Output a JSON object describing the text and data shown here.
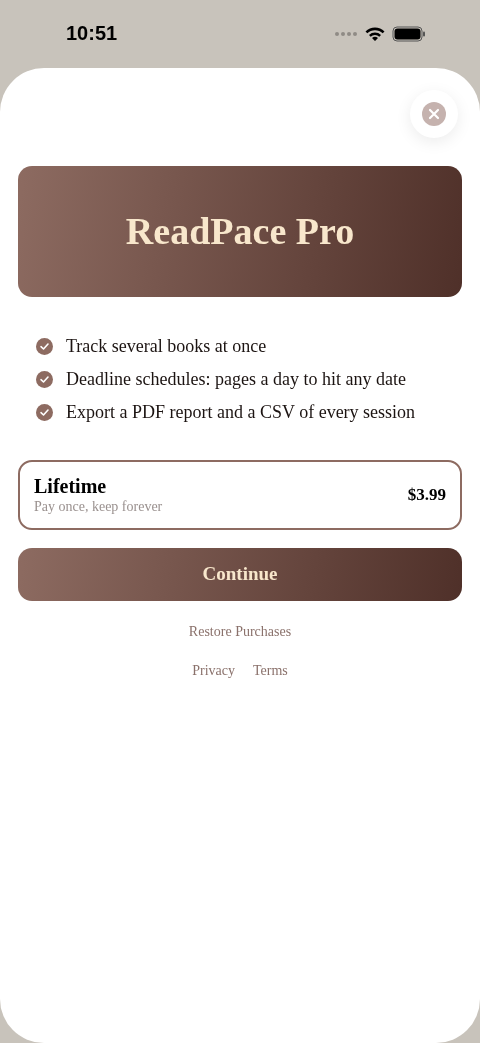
{
  "status_bar": {
    "time": "10:51"
  },
  "hero": {
    "title": "ReadPace Pro"
  },
  "features": [
    {
      "text": "Track several books at once",
      "checked": true
    },
    {
      "text": "Deadline schedules: pages a day to hit any date",
      "checked": true
    },
    {
      "text": "Export a PDF report and a CSV of every session",
      "checked": true
    }
  ],
  "plans": [
    {
      "name": "Lifetime",
      "subtitle": "Pay once, keep forever",
      "price": "$3.99",
      "selected": true
    }
  ],
  "continue_button": "Continue",
  "restore_link": "Restore Purchases",
  "footer_links": [
    "Privacy",
    "Terms"
  ]
}
